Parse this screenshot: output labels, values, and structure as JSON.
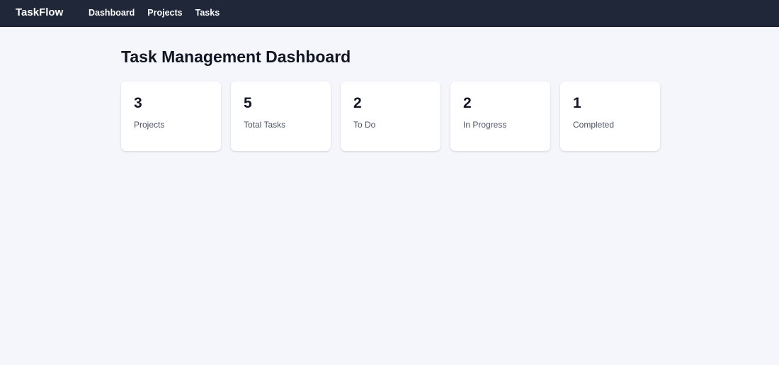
{
  "navbar": {
    "brand": "TaskFlow",
    "links": [
      {
        "label": "Dashboard"
      },
      {
        "label": "Projects"
      },
      {
        "label": "Tasks"
      }
    ]
  },
  "main": {
    "title": "Task Management Dashboard",
    "stats": [
      {
        "value": "3",
        "label": "Projects"
      },
      {
        "value": "5",
        "label": "Total Tasks"
      },
      {
        "value": "2",
        "label": "To Do"
      },
      {
        "value": "2",
        "label": "In Progress"
      },
      {
        "value": "1",
        "label": "Completed"
      }
    ]
  },
  "colors": {
    "navbar_bg": "#1f2738",
    "page_bg": "#f5f6fb",
    "card_bg": "#ffffff",
    "heading_text": "#111622",
    "label_text": "#4a5263"
  }
}
